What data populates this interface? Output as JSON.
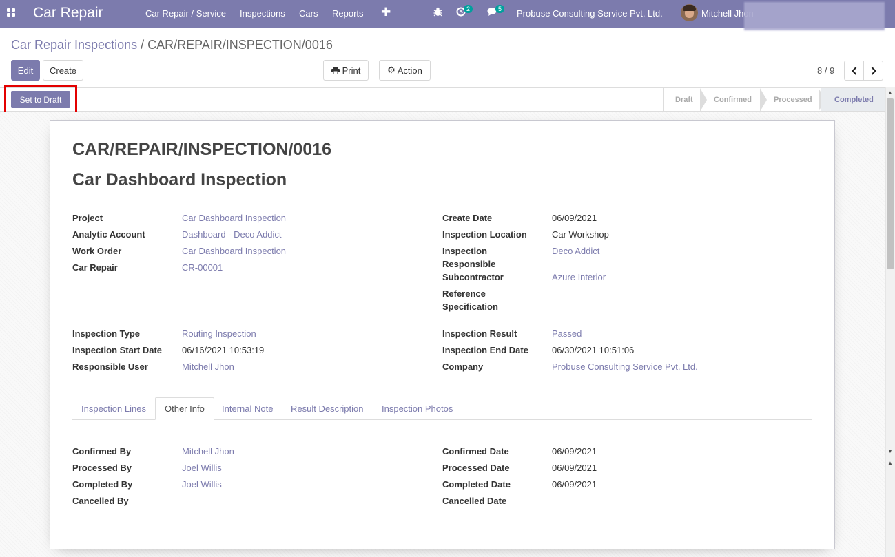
{
  "navbar": {
    "brand": "Car Repair",
    "menu": [
      "Car Repair / Service",
      "Inspections",
      "Cars",
      "Reports"
    ],
    "activity_count": "2",
    "message_count": "5",
    "company": "Probuse Consulting Service Pvt. Ltd.",
    "user": "Mitchell Jhon",
    "icons": [
      "apps-icon",
      "plus-icon",
      "bug-icon",
      "clock-icon",
      "chat-icon"
    ]
  },
  "breadcrumb": {
    "parent": "Car Repair Inspections",
    "separator": "/",
    "current": "CAR/REPAIR/INSPECTION/0016"
  },
  "buttons": {
    "edit": "Edit",
    "create": "Create",
    "print": "Print",
    "action": "Action",
    "set_to_draft": "Set to Draft"
  },
  "pager": {
    "value": "8 / 9"
  },
  "stages": [
    {
      "label": "Draft",
      "active": false
    },
    {
      "label": "Confirmed",
      "active": false
    },
    {
      "label": "Processed",
      "active": false
    },
    {
      "label": "Completed",
      "active": true
    }
  ],
  "record": {
    "name": "CAR/REPAIR/INSPECTION/0016",
    "title": "Car Dashboard Inspection"
  },
  "fields_left_1": [
    {
      "label": "Project",
      "value": "Car Dashboard Inspection"
    },
    {
      "label": "Analytic Account",
      "value": "Dashboard - Deco Addict"
    },
    {
      "label": "Work Order",
      "value": "Car Dashboard Inspection"
    },
    {
      "label": "Car Repair",
      "value": "CR-00001"
    }
  ],
  "fields_right_1": [
    {
      "label": "Create Date",
      "value": "06/09/2021"
    },
    {
      "label": "Inspection Location",
      "value": "Car Workshop"
    },
    {
      "label": "Inspection Responsible",
      "value": "Deco Addict"
    },
    {
      "label": "Subcontractor",
      "value": "Azure Interior"
    },
    {
      "label": "Reference Specification",
      "value": ""
    }
  ],
  "fields_left_2": [
    {
      "label": "Inspection Type",
      "value": "Routing Inspection"
    },
    {
      "label": "Inspection Start Date",
      "value": "06/16/2021 10:53:19"
    },
    {
      "label": "Responsible User",
      "value": "Mitchell Jhon"
    }
  ],
  "fields_right_2": [
    {
      "label": "Inspection Result",
      "value": "Passed"
    },
    {
      "label": "Inspection End Date",
      "value": "06/30/2021 10:51:06"
    },
    {
      "label": "Company",
      "value": "Probuse Consulting Service Pvt. Ltd."
    }
  ],
  "tabs": [
    {
      "label": "Inspection Lines",
      "active": false
    },
    {
      "label": "Other Info",
      "active": true
    },
    {
      "label": "Internal Note",
      "active": false
    },
    {
      "label": "Result Description",
      "active": false
    },
    {
      "label": "Inspection Photos",
      "active": false
    }
  ],
  "other_left": [
    {
      "label": "Confirmed By",
      "value": "Mitchell Jhon"
    },
    {
      "label": "Processed By",
      "value": "Joel Willis"
    },
    {
      "label": "Completed By",
      "value": "Joel Willis"
    },
    {
      "label": "Cancelled By",
      "value": ""
    }
  ],
  "other_right": [
    {
      "label": "Confirmed Date",
      "value": "06/09/2021"
    },
    {
      "label": "Processed Date",
      "value": "06/09/2021"
    },
    {
      "label": "Completed Date",
      "value": "06/09/2021"
    },
    {
      "label": "Cancelled Date",
      "value": ""
    }
  ]
}
